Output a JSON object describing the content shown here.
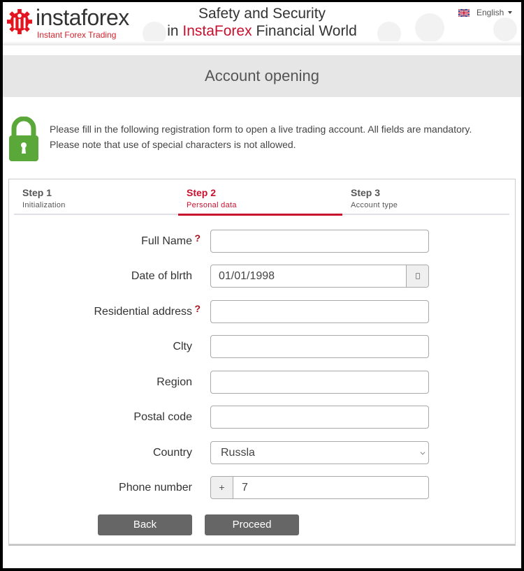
{
  "header": {
    "logo_word": "instaforex",
    "logo_tagline": "Instant Forex Trading",
    "slogan_line1": "Safety and Security",
    "slogan_line2_prefix": "in ",
    "slogan_brand": "InstaForex",
    "slogan_line2_suffix": " Financial World",
    "language": {
      "label": "English",
      "flag_icon": "uk-flag-icon"
    }
  },
  "title": "Account opening",
  "notice": {
    "icon": "padlock-icon",
    "line1": "Please fill in the following registration form to open a live trading account. All fields are mandatory.",
    "line2": "Please note that use of special characters is not allowed."
  },
  "steps": [
    {
      "num": "Step 1",
      "label": "Initialization",
      "active": false
    },
    {
      "num": "Step 2",
      "label": "Personal data",
      "active": true
    },
    {
      "num": "Step 3",
      "label": "Account type",
      "active": false
    }
  ],
  "form": {
    "full_name": {
      "label": "Full Name",
      "help": "?",
      "value": ""
    },
    "dob": {
      "label": "Date of blrth",
      "value": "01/01/1998"
    },
    "address": {
      "label": "Residential address",
      "help": "?",
      "value": ""
    },
    "city": {
      "label": "Clty",
      "value": ""
    },
    "region": {
      "label": "Region",
      "value": ""
    },
    "postal": {
      "label": "Postal code",
      "value": ""
    },
    "country": {
      "label": "Country",
      "value": "Russla"
    },
    "phone": {
      "label": "Phone number",
      "prefix": "+",
      "value": "7"
    }
  },
  "buttons": {
    "back": "Back",
    "proceed": "Proceed"
  },
  "colors": {
    "brand_red": "#c8102e",
    "lock_green": "#5aa83a",
    "button_gray": "#666666"
  }
}
